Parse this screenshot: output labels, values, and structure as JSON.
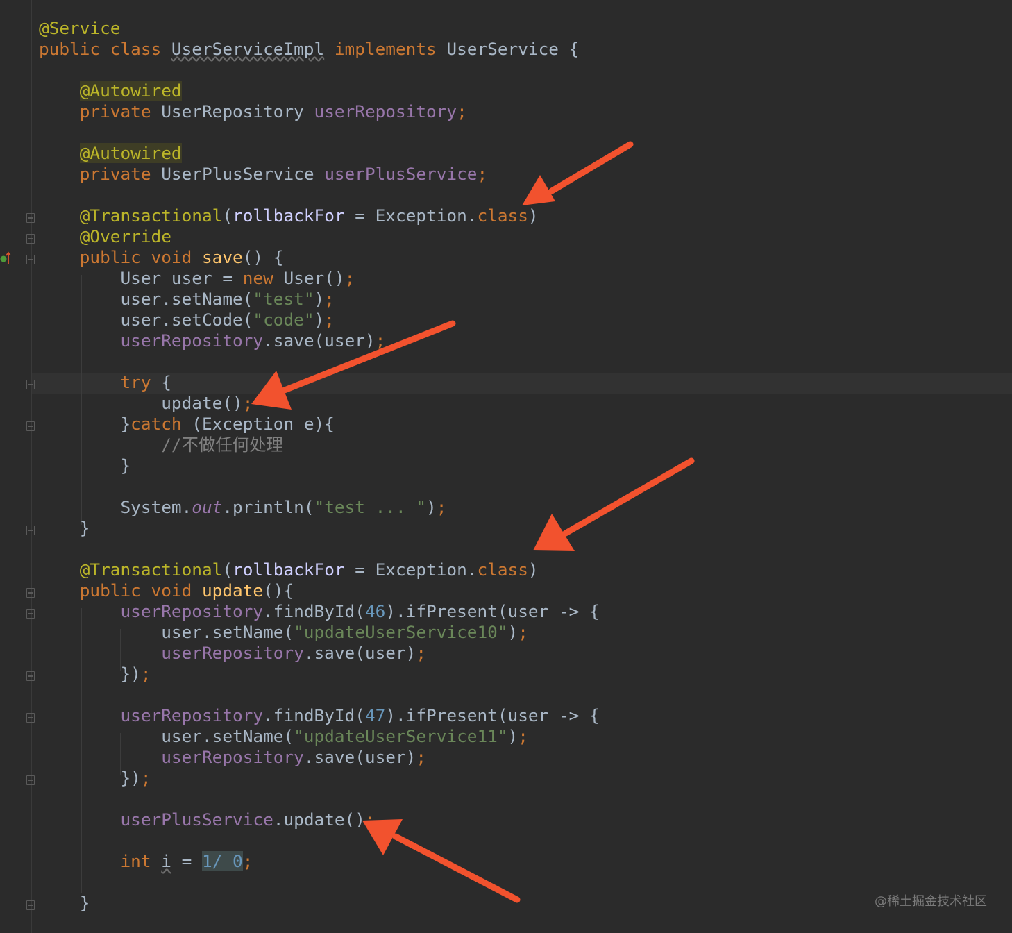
{
  "editor": {
    "lines": {
      "l1": "@Service",
      "l2_kw": "public class ",
      "l2_cls": "UserServiceImpl",
      "l2_impl": " implements ",
      "l2_rest": "UserService {",
      "ann_autowired": "@Autowired",
      "priv": "private ",
      "repo_type": "UserRepository ",
      "repo_field": "userRepository",
      "plus_type": "UserPlusService ",
      "plus_field": "userPlusService",
      "semi": ";",
      "tx_ann": "@Transactional",
      "tx_open": "(",
      "tx_arg": "rollbackFor",
      "tx_eq": " = Exception.",
      "tx_class": "class",
      "tx_close": ")",
      "override": "@Override",
      "pub_void": "public void ",
      "save_name": "save",
      "save_rest": "() {",
      "user_decl": "User user = ",
      "new_kw": "new",
      "user_ctor": " User()",
      "set_name": "user.setName(",
      "str_test": "\"test\"",
      "close_paren": ")",
      "set_code": "user.setCode(",
      "str_code": "\"code\"",
      "save_call": ".save(user)",
      "try_kw": "try",
      "try_rest": " {",
      "update_call": "update()",
      "catch_open": "}",
      "catch_kw": "catch",
      "catch_rest": " (Exception e){",
      "comment": "//不做任何处理",
      "close_brace": "}",
      "sys": "System.",
      "out": "out",
      "println": ".println(",
      "str_testdots": "\"test ... \"",
      "update_name": "update",
      "update_rest": "(){",
      "find_by_id": ".findById(",
      "num_46": "46",
      "if_present": ").ifPresent(user -> {",
      "str_us10": "\"updateUserService10\"",
      "close_lambda": "})",
      "num_47": "47",
      "str_us11": "\"updateUserService11\"",
      "plus_update": ".update()",
      "int_kw": "int ",
      "var_i": "i",
      "eq": " = ",
      "div_1": "1/",
      "space": " ",
      "div_0": "0"
    }
  },
  "watermark": "@稀土掘金技术社区",
  "colors": {
    "background": "#2b2b2b",
    "keyword": "#cc7832",
    "annotation": "#bbb529",
    "field": "#9876aa",
    "string": "#6a8759",
    "number": "#6897bb",
    "function": "#ffc66d",
    "arrow": "#f2522e"
  }
}
